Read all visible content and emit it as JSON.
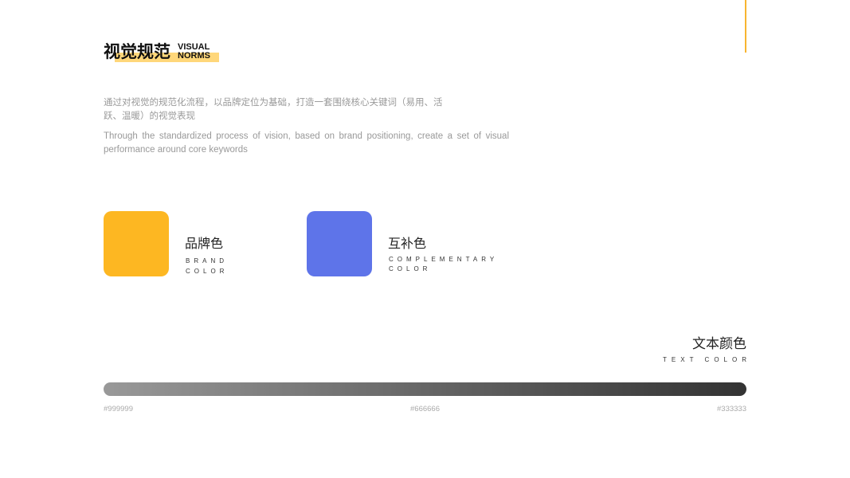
{
  "title": {
    "cn": "视觉规范",
    "en_line1": "VISUAL",
    "en_line2": "NORMS"
  },
  "description": {
    "cn": "通过对视觉的规范化流程，以品牌定位为基础，打造一套围绕核心关键词（易用、活跃、温暖）的视觉表现",
    "en": "Through the standardized process of vision, based on brand positioning, create a set of visual performance around core keywords"
  },
  "brand_color": {
    "cn": "品牌色",
    "en_line1": "BRAND",
    "en_line2": "COLOR",
    "hex": "#FDB722"
  },
  "complementary_color": {
    "cn": "互补色",
    "en_line1": "COMPLEMENTARY",
    "en_line2": "COLOR",
    "hex": "#5E74E9"
  },
  "text_color": {
    "cn": "文本颜色",
    "en": "TEXT COLOR",
    "stops": [
      {
        "label": "#999999",
        "hex": "#999999"
      },
      {
        "label": "#666666",
        "hex": "#666666"
      },
      {
        "label": "#333333",
        "hex": "#333333"
      }
    ]
  },
  "colors": {
    "accent_line": "#F8B530",
    "title_highlight": "#FFD77A"
  }
}
